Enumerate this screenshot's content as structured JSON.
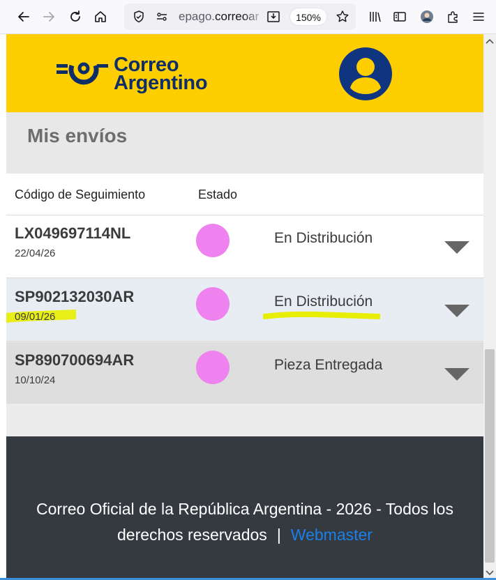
{
  "browser": {
    "url_host_prefix": "epago.",
    "url_host_main": "correoar",
    "zoom_level": "150%"
  },
  "header": {
    "logo_line1": "Correo",
    "logo_line2": "Argentino",
    "brand_color": "#ffce00",
    "brand_blue": "#0f2e67"
  },
  "page": {
    "title": "Mis envíos"
  },
  "table": {
    "col_tracking": "Código de Seguimiento",
    "col_status": "Estado",
    "rows": [
      {
        "code": "LX049697114NL",
        "date": "22/04/26",
        "status": "En Distribución",
        "bg": "#ffffff"
      },
      {
        "code": "SP902132030AR",
        "date": "09/01/26",
        "status": "En Distribución",
        "bg": "#e8ecf3"
      },
      {
        "code": "SP890700694AR",
        "date": "10/10/24",
        "status": "Pieza Entregada",
        "bg": "#dedede"
      }
    ],
    "status_dot_color": "#ee82ee",
    "highlight_color": "#e8ee00"
  },
  "footer": {
    "text_line": "Correo Oficial de la República Argentina - 2026 - Todos los derechos reservados",
    "separator": "|",
    "webmaster_label": "Webmaster"
  }
}
